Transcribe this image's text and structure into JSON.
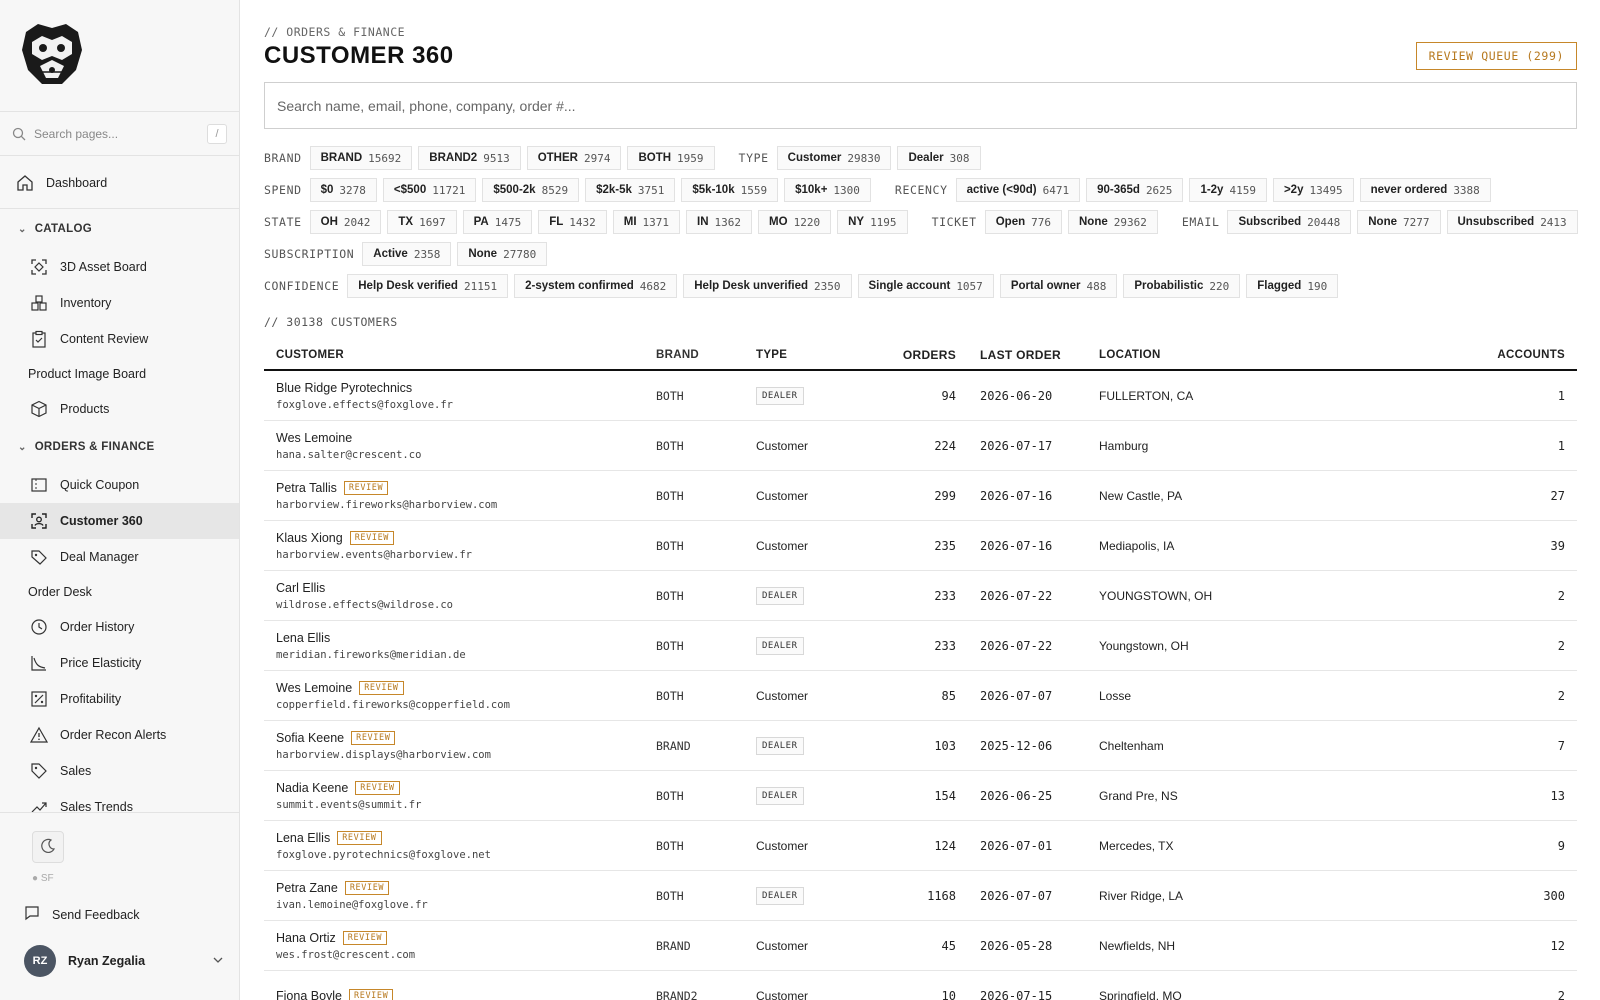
{
  "sidebar": {
    "search_placeholder": "Search pages...",
    "search_shortcut": "/",
    "dashboard": "Dashboard",
    "catalog_section": "CATALOG",
    "catalog_items": [
      "3D Asset Board",
      "Inventory",
      "Content Review"
    ],
    "product_image_board": "Product Image Board",
    "products": "Products",
    "orders_section": "ORDERS & FINANCE",
    "quick_coupon": "Quick Coupon",
    "customer_360": "Customer 360",
    "deal_manager": "Deal Manager",
    "order_desk": "Order Desk",
    "order_items": [
      "Order History",
      "Price Elasticity",
      "Profitability",
      "Order Recon Alerts",
      "Sales",
      "Sales Trends"
    ],
    "status_label": "SF",
    "send_feedback": "Send Feedback",
    "user_initials": "RZ",
    "user_name": "Ryan Zegalia"
  },
  "header": {
    "breadcrumb": "// ORDERS & FINANCE",
    "title": "CUSTOMER 360",
    "review_queue": "REVIEW QUEUE (299)",
    "search_placeholder": "Search name, email, phone, company, order #..."
  },
  "filters": {
    "brand_label": "BRAND",
    "brand": [
      {
        "label": "BRAND",
        "count": "15692"
      },
      {
        "label": "BRAND2",
        "count": "9513"
      },
      {
        "label": "OTHER",
        "count": "2974"
      },
      {
        "label": "BOTH",
        "count": "1959"
      }
    ],
    "type_label": "TYPE",
    "type": [
      {
        "label": "Customer",
        "count": "29830"
      },
      {
        "label": "Dealer",
        "count": "308"
      }
    ],
    "spend_label": "SPEND",
    "spend": [
      {
        "label": "$0",
        "count": "3278"
      },
      {
        "label": "<$500",
        "count": "11721"
      },
      {
        "label": "$500-2k",
        "count": "8529"
      },
      {
        "label": "$2k-5k",
        "count": "3751"
      },
      {
        "label": "$5k-10k",
        "count": "1559"
      },
      {
        "label": "$10k+",
        "count": "1300"
      }
    ],
    "recency_label": "RECENCY",
    "recency": [
      {
        "label": "active (<90d)",
        "count": "6471"
      },
      {
        "label": "90-365d",
        "count": "2625"
      },
      {
        "label": "1-2y",
        "count": "4159"
      },
      {
        "label": ">2y",
        "count": "13495"
      },
      {
        "label": "never ordered",
        "count": "3388"
      }
    ],
    "state_label": "STATE",
    "state": [
      {
        "label": "OH",
        "count": "2042"
      },
      {
        "label": "TX",
        "count": "1697"
      },
      {
        "label": "PA",
        "count": "1475"
      },
      {
        "label": "FL",
        "count": "1432"
      },
      {
        "label": "MI",
        "count": "1371"
      },
      {
        "label": "IN",
        "count": "1362"
      },
      {
        "label": "MO",
        "count": "1220"
      },
      {
        "label": "NY",
        "count": "1195"
      }
    ],
    "ticket_label": "TICKET",
    "ticket": [
      {
        "label": "Open",
        "count": "776"
      },
      {
        "label": "None",
        "count": "29362"
      }
    ],
    "email_label": "EMAIL",
    "email": [
      {
        "label": "Subscribed",
        "count": "20448"
      },
      {
        "label": "None",
        "count": "7277"
      },
      {
        "label": "Unsubscribed",
        "count": "2413"
      }
    ],
    "subscription_label": "SUBSCRIPTION",
    "subscription": [
      {
        "label": "Active",
        "count": "2358"
      },
      {
        "label": "None",
        "count": "27780"
      }
    ],
    "confidence_label": "CONFIDENCE",
    "confidence": [
      {
        "label": "Help Desk verified",
        "count": "21151"
      },
      {
        "label": "2-system confirmed",
        "count": "4682"
      },
      {
        "label": "Help Desk unverified",
        "count": "2350"
      },
      {
        "label": "Single account",
        "count": "1057"
      },
      {
        "label": "Portal owner",
        "count": "488"
      },
      {
        "label": "Probabilistic",
        "count": "220"
      },
      {
        "label": "Flagged",
        "count": "190"
      }
    ]
  },
  "table": {
    "count_line": "// 30138 CUSTOMERS",
    "headers": {
      "customer": "CUSTOMER",
      "brand": "BRAND",
      "type": "TYPE",
      "orders": "ORDERS",
      "last_order": "LAST ORDER",
      "location": "LOCATION",
      "accounts": "ACCOUNTS"
    },
    "review_badge": "REVIEW",
    "rows": [
      {
        "name": "Blue Ridge Pyrotechnics",
        "email": "foxglove.effects@foxglove.fr",
        "review": false,
        "brand": "BOTH",
        "type": "DEALER",
        "dealer": true,
        "orders": "94",
        "last_order": "2026-06-20",
        "location": "FULLERTON, CA",
        "accounts": "1"
      },
      {
        "name": "Wes Lemoine",
        "email": "hana.salter@crescent.co",
        "review": false,
        "brand": "BOTH",
        "type": "Customer",
        "dealer": false,
        "orders": "224",
        "last_order": "2026-07-17",
        "location": "Hamburg",
        "accounts": "1"
      },
      {
        "name": "Petra Tallis",
        "email": "harborview.fireworks@harborview.com",
        "review": true,
        "brand": "BOTH",
        "type": "Customer",
        "dealer": false,
        "orders": "299",
        "last_order": "2026-07-16",
        "location": "New Castle, PA",
        "accounts": "27"
      },
      {
        "name": "Klaus Xiong",
        "email": "harborview.events@harborview.fr",
        "review": true,
        "brand": "BOTH",
        "type": "Customer",
        "dealer": false,
        "orders": "235",
        "last_order": "2026-07-16",
        "location": "Mediapolis, IA",
        "accounts": "39"
      },
      {
        "name": "Carl Ellis",
        "email": "wildrose.effects@wildrose.co",
        "review": false,
        "brand": "BOTH",
        "type": "DEALER",
        "dealer": true,
        "orders": "233",
        "last_order": "2026-07-22",
        "location": "YOUNGSTOWN, OH",
        "accounts": "2"
      },
      {
        "name": "Lena Ellis",
        "email": "meridian.fireworks@meridian.de",
        "review": false,
        "brand": "BOTH",
        "type": "DEALER",
        "dealer": true,
        "orders": "233",
        "last_order": "2026-07-22",
        "location": "Youngstown, OH",
        "accounts": "2"
      },
      {
        "name": "Wes Lemoine",
        "email": "copperfield.fireworks@copperfield.com",
        "review": true,
        "brand": "BOTH",
        "type": "Customer",
        "dealer": false,
        "orders": "85",
        "last_order": "2026-07-07",
        "location": "Losse",
        "accounts": "2"
      },
      {
        "name": "Sofia Keene",
        "email": "harborview.displays@harborview.com",
        "review": true,
        "brand": "BRAND",
        "type": "DEALER",
        "dealer": true,
        "orders": "103",
        "last_order": "2025-12-06",
        "location": "Cheltenham",
        "accounts": "7"
      },
      {
        "name": "Nadia Keene",
        "email": "summit.events@summit.fr",
        "review": true,
        "brand": "BOTH",
        "type": "DEALER",
        "dealer": true,
        "orders": "154",
        "last_order": "2026-06-25",
        "location": "Grand Pre, NS",
        "accounts": "13"
      },
      {
        "name": "Lena Ellis",
        "email": "foxglove.pyrotechnics@foxglove.net",
        "review": true,
        "brand": "BOTH",
        "type": "Customer",
        "dealer": false,
        "orders": "124",
        "last_order": "2026-07-01",
        "location": "Mercedes, TX",
        "accounts": "9"
      },
      {
        "name": "Petra Zane",
        "email": "ivan.lemoine@foxglove.fr",
        "review": true,
        "brand": "BOTH",
        "type": "DEALER",
        "dealer": true,
        "orders": "1168",
        "last_order": "2026-07-07",
        "location": "River Ridge, LA",
        "accounts": "300"
      },
      {
        "name": "Hana Ortiz",
        "email": "wes.frost@crescent.com",
        "review": true,
        "brand": "BRAND",
        "type": "Customer",
        "dealer": false,
        "orders": "45",
        "last_order": "2026-05-28",
        "location": "Newfields, NH",
        "accounts": "12"
      },
      {
        "name": "Fiona Boyle",
        "email": "",
        "review": true,
        "brand": "BRAND2",
        "type": "Customer",
        "dealer": false,
        "orders": "10",
        "last_order": "2026-07-15",
        "location": "Springfield, MO",
        "accounts": "2"
      }
    ]
  },
  "colors": {
    "accent": "#b7791f",
    "sidebar_bg": "#f7f7f7",
    "active_bg": "#e6e6e6"
  }
}
